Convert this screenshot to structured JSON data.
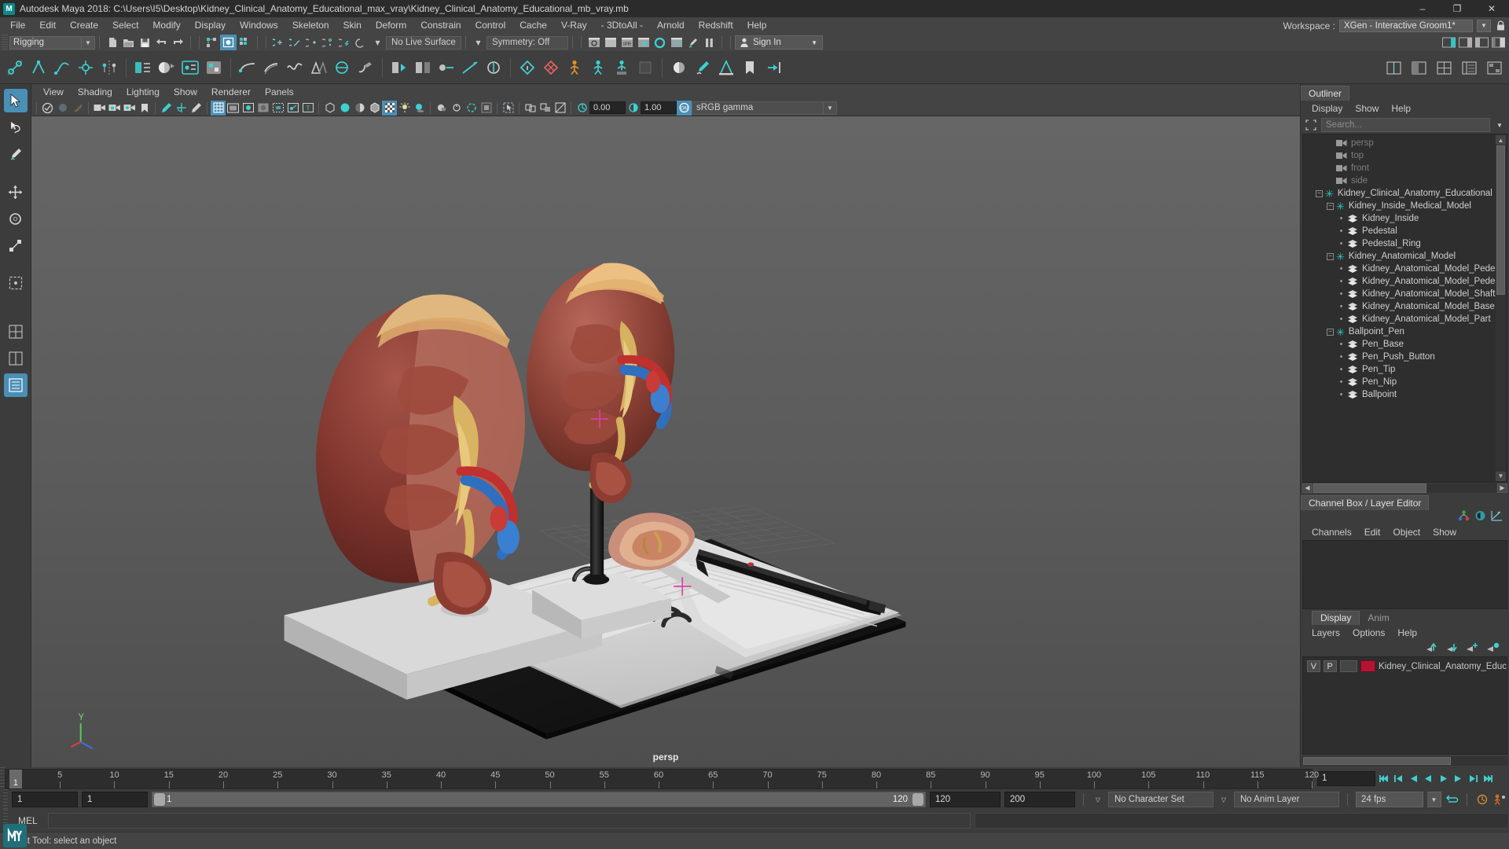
{
  "titlebar": {
    "app_title": "Autodesk Maya 2018: C:\\Users\\I5\\Desktop\\Kidney_Clinical_Anatomy_Educational_max_vray\\Kidney_Clinical_Anatomy_Educational_mb_vray.mb",
    "logo_text": "M",
    "minimize": "–",
    "maximize": "❐",
    "close": "✕"
  },
  "menubar": {
    "items": [
      "File",
      "Edit",
      "Create",
      "Select",
      "Modify",
      "Display",
      "Windows",
      "Skeleton",
      "Skin",
      "Deform",
      "Constrain",
      "Control",
      "Cache",
      "V-Ray",
      "- 3DtoAll -",
      "Arnold",
      "Redshift",
      "Help"
    ],
    "workspace_label": "Workspace :",
    "workspace_value": "XGen - Interactive Groom1*"
  },
  "statusline": {
    "mode": "Rigging",
    "live_surface": "No Live Surface",
    "symmetry": "Symmetry: Off",
    "signin": "Sign In"
  },
  "viewport_menu": {
    "items": [
      "View",
      "Shading",
      "Lighting",
      "Show",
      "Renderer",
      "Panels"
    ]
  },
  "viewport_toolbar": {
    "exposure": "0.00",
    "gamma": "1.00",
    "color_space": "sRGB gamma"
  },
  "viewport": {
    "camera_label": "persp",
    "axis_y": "Y"
  },
  "outliner": {
    "tab": "Outliner",
    "menus": [
      "Display",
      "Show",
      "Help"
    ],
    "search_placeholder": "Search...",
    "items": [
      {
        "label": "persp",
        "depth": 1,
        "icon": "camera",
        "dim": true,
        "expander": "none"
      },
      {
        "label": "top",
        "depth": 1,
        "icon": "camera",
        "dim": true,
        "expander": "none"
      },
      {
        "label": "front",
        "depth": 1,
        "icon": "camera",
        "dim": true,
        "expander": "none"
      },
      {
        "label": "side",
        "depth": 1,
        "icon": "camera",
        "dim": true,
        "expander": "none"
      },
      {
        "label": "Kidney_Clinical_Anatomy_Educational",
        "depth": 0,
        "icon": "group",
        "dim": false,
        "expander": "minus"
      },
      {
        "label": "Kidney_Inside_Medical_Model",
        "depth": 1,
        "icon": "group",
        "dim": false,
        "expander": "minus"
      },
      {
        "label": "Kidney_Inside",
        "depth": 2,
        "icon": "mesh",
        "dim": false,
        "expander": "dot"
      },
      {
        "label": "Pedestal",
        "depth": 2,
        "icon": "mesh",
        "dim": false,
        "expander": "dot"
      },
      {
        "label": "Pedestal_Ring",
        "depth": 2,
        "icon": "mesh",
        "dim": false,
        "expander": "dot"
      },
      {
        "label": "Kidney_Anatomical_Model",
        "depth": 1,
        "icon": "group",
        "dim": false,
        "expander": "minus"
      },
      {
        "label": "Kidney_Anatomical_Model_Pedes",
        "depth": 2,
        "icon": "mesh",
        "dim": false,
        "expander": "dot"
      },
      {
        "label": "Kidney_Anatomical_Model_Pedes",
        "depth": 2,
        "icon": "mesh",
        "dim": false,
        "expander": "dot"
      },
      {
        "label": "Kidney_Anatomical_Model_Shaft",
        "depth": 2,
        "icon": "mesh",
        "dim": false,
        "expander": "dot"
      },
      {
        "label": "Kidney_Anatomical_Model_Base",
        "depth": 2,
        "icon": "mesh",
        "dim": false,
        "expander": "dot"
      },
      {
        "label": "Kidney_Anatomical_Model_Part",
        "depth": 2,
        "icon": "mesh",
        "dim": false,
        "expander": "dot"
      },
      {
        "label": "Ballpoint_Pen",
        "depth": 1,
        "icon": "group",
        "dim": false,
        "expander": "minus"
      },
      {
        "label": "Pen_Base",
        "depth": 2,
        "icon": "mesh",
        "dim": false,
        "expander": "dot"
      },
      {
        "label": "Pen_Push_Button",
        "depth": 2,
        "icon": "mesh",
        "dim": false,
        "expander": "dot"
      },
      {
        "label": "Pen_Tip",
        "depth": 2,
        "icon": "mesh",
        "dim": false,
        "expander": "dot"
      },
      {
        "label": "Pen_Nip",
        "depth": 2,
        "icon": "mesh",
        "dim": false,
        "expander": "dot"
      },
      {
        "label": "Ballpoint",
        "depth": 2,
        "icon": "mesh",
        "dim": false,
        "expander": "dot"
      }
    ]
  },
  "channelbox": {
    "tab": "Channel Box / Layer Editor",
    "menus": [
      "Channels",
      "Edit",
      "Object",
      "Show"
    ]
  },
  "layer_editor": {
    "tabs": [
      {
        "label": "Display",
        "selected": true
      },
      {
        "label": "Anim",
        "selected": false
      }
    ],
    "menus": [
      "Layers",
      "Options",
      "Help"
    ],
    "layers": [
      {
        "visible": "V",
        "playback": "P",
        "color": "#b41432",
        "name": "Kidney_Clinical_Anatomy_Educ"
      }
    ]
  },
  "timeline": {
    "current_frame": "1",
    "ticks": [
      5,
      10,
      15,
      20,
      25,
      30,
      35,
      40,
      45,
      50,
      55,
      60,
      65,
      70,
      75,
      80,
      85,
      90,
      95,
      100,
      105,
      110,
      115,
      120
    ],
    "goto_frame": "1"
  },
  "range": {
    "start": "1",
    "start2": "1",
    "slider_min": "1",
    "slider_max": "120",
    "anim_end": "120",
    "playback_end": "200",
    "character_set": "No Character Set",
    "anim_layer": "No Anim Layer",
    "fps": "24 fps"
  },
  "command_line": {
    "language": "MEL",
    "value": ""
  },
  "statusbar": {
    "help_text": "Select Tool: select an object"
  },
  "colors": {
    "accent": "#4a8fb5",
    "teal": "#2fc6c6",
    "layer_red": "#b41432",
    "panel_bg": "#3c3c3c",
    "dark_bg": "#2e2e2e"
  }
}
